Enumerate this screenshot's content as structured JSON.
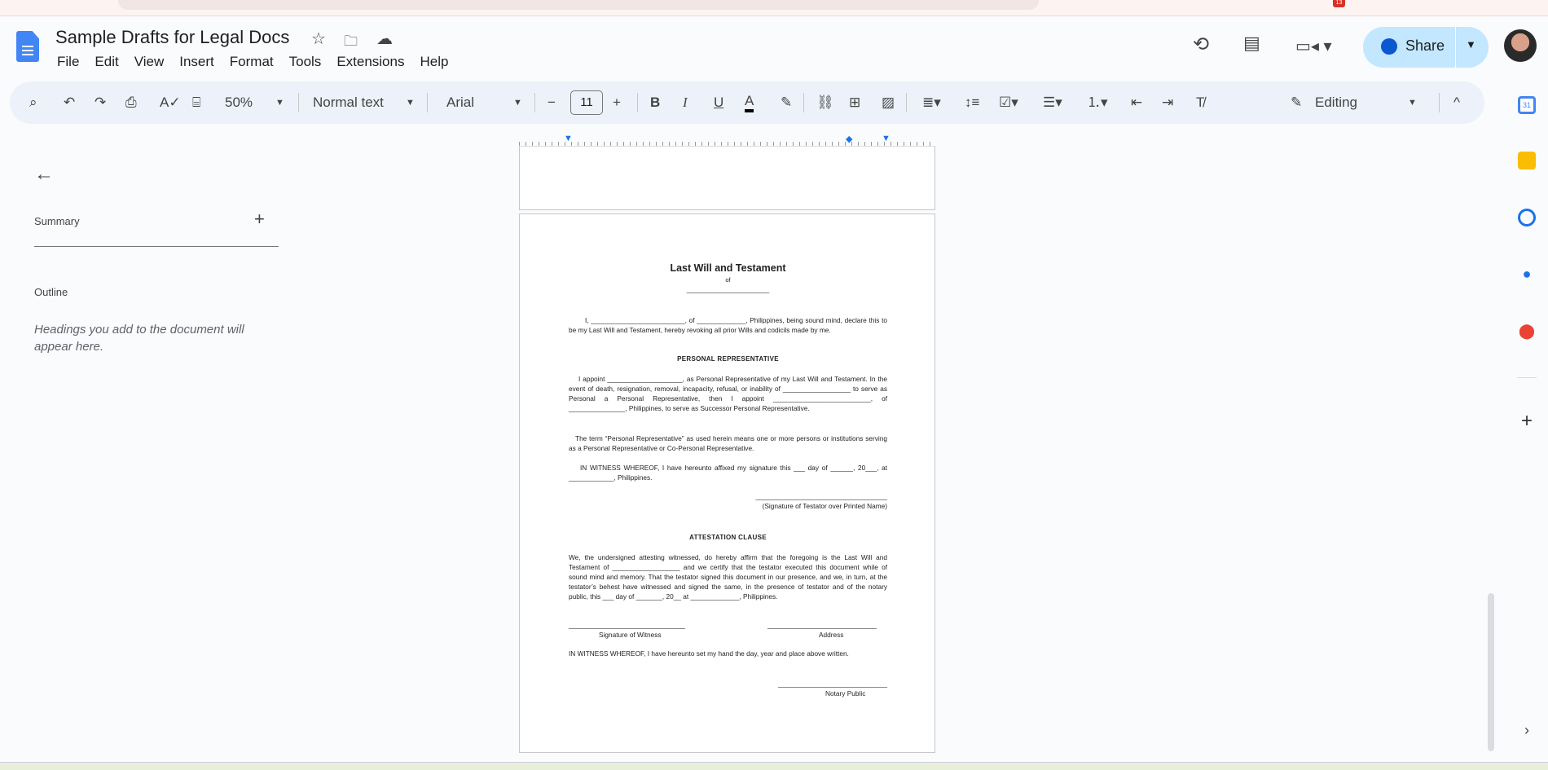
{
  "header": {
    "title": "Sample Drafts for Legal Docs",
    "share_label": "Share",
    "notification_count": "13"
  },
  "menu": [
    "File",
    "Edit",
    "View",
    "Insert",
    "Format",
    "Tools",
    "Extensions",
    "Help"
  ],
  "toolbar": {
    "zoom": "50%",
    "style": "Normal text",
    "font": "Arial",
    "font_size": "11",
    "mode": "Editing"
  },
  "sidebar": {
    "summary": "Summary",
    "outline": "Outline",
    "outline_hint": "Headings you add to the document will appear here."
  },
  "doc": {
    "title": "Last Will and Testament",
    "of": "of",
    "blank": "______________________",
    "p1": "I, _________________________, of _____________, Philippines, being sound mind, declare this to be my Last Will and Testament, hereby revoking all prior Wills and codicils made by me.",
    "h1": "PERSONAL REPRESENTATIVE",
    "p2": "I appoint ____________________, as Personal Representative of my Last Will and Testament. In the event of death, resignation, removal, incapacity, refusal, or inability of __________________ to serve as Personal a Personal Representative, then I appoint __________________________, of _______________, Philippines, to serve as Successor Personal Representative.",
    "p3": "The term “Personal Representative” as used herein means one or more persons or institutions serving as a Personal Representative or Co-Personal Representative.",
    "p4": "IN WITNESS WHEREOF, I have hereunto affixed my signature this ___ day of ______, 20___, at ____________, Philippines.",
    "sig_line": "___________________________________",
    "sig_caption": "(Signature of Testator over Printed Name)",
    "h2": "ATTESTATION CLAUSE",
    "p5": "We, the undersigned attesting witnessed, do hereby affirm that the foregoing is the Last Will and Testament of __________________ and we certify that the testator executed this document while of sound mind and memory. That the testator signed this document in our presence, and we, in turn, at the testator’s behest have witnessed and signed the same, in the presence of testator and of the notary public, this ___ day of _______, 20__ at _____________, Philippines.",
    "witness_line": "_______________________________",
    "witness_label": "Signature of Witness",
    "address_line": "_____________________________",
    "address_label": "Address",
    "p6": "IN WITNESS WHEREOF, I have hereunto set my hand the day, year and place above written.",
    "notary_line": "_____________________________",
    "notary_label": "Notary Public"
  }
}
